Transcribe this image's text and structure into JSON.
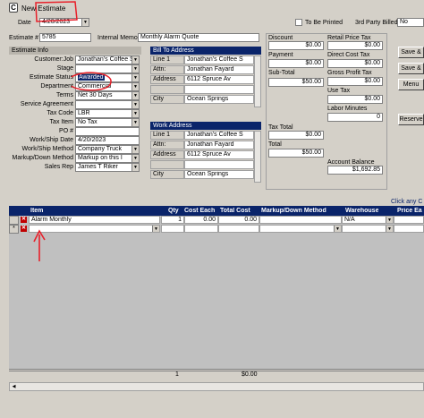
{
  "window": {
    "title": "New Estimate"
  },
  "header": {
    "date_label": "Date",
    "date_value": "4/20/2023",
    "to_be_printed": "To Be Printed",
    "third_party": "3rd Party Billed",
    "third_party_value": "No"
  },
  "estimate": {
    "number_label": "Estimate #",
    "number_value": "5785",
    "memo_label": "Internal Memo",
    "memo_value": "Monthly Alarm Quote"
  },
  "info": {
    "title": "Estimate Info",
    "rows": [
      {
        "label": "Customer:Job",
        "value": "Jonathan's Coffee S"
      },
      {
        "label": "Stage",
        "value": ""
      },
      {
        "label": "Estimate Status",
        "value": "Awarded"
      },
      {
        "label": "Department",
        "value": "Commercial"
      },
      {
        "label": "Terms",
        "value": "Net 30 Days"
      },
      {
        "label": "Service Agreement",
        "value": ""
      },
      {
        "label": "Tax Code",
        "value": "LBR"
      },
      {
        "label": "Tax Item",
        "value": "No Tax"
      },
      {
        "label": "PO #",
        "value": ""
      },
      {
        "label": "Work/Ship Date",
        "value": "4/20/2023"
      },
      {
        "label": "Work/Ship Method",
        "value": "Company Truck"
      },
      {
        "label": "Markup/Down Method",
        "value": "Markup on this I"
      },
      {
        "label": "Sales Rep",
        "value": "James T Riker"
      }
    ]
  },
  "bill_to": {
    "title": "Bill To Address",
    "rows": [
      {
        "label": "Line 1",
        "value": "Jonathan's Coffee S"
      },
      {
        "label": "Attn:",
        "value": "Jonathan Fayard"
      },
      {
        "label": "Address",
        "value": "6112 Spruce Av"
      },
      {
        "label": "",
        "value": ""
      },
      {
        "label": "City",
        "value": "Ocean Springs"
      }
    ]
  },
  "work_address": {
    "title": "Work Address",
    "rows": [
      {
        "label": "Line 1",
        "value": "Jonathan's Coffee S"
      },
      {
        "label": "Attn:",
        "value": "Jonathan Fayard"
      },
      {
        "label": "Address",
        "value": "6112 Spruce Av"
      },
      {
        "label": "",
        "value": ""
      },
      {
        "label": "City",
        "value": "Ocean Springs"
      }
    ]
  },
  "totals_left": {
    "discount_label": "Discount",
    "discount_value": "$0.00",
    "payment_label": "Payment",
    "payment_value": "$0.00",
    "subtotal_label": "Sub-Total",
    "subtotal_value": "$50.00",
    "taxtotal_label": "Tax Total",
    "taxtotal_value": "$0.00",
    "total_label": "Total",
    "total_value": "$50.00"
  },
  "totals_right": {
    "retail_label": "Retail Price Tax",
    "retail_value": "$0.00",
    "direct_label": "Direct Cost Tax",
    "direct_value": "$0.00",
    "gross_label": "Gross Profit Tax",
    "gross_value": "$0.00",
    "usetax_label": "Use Tax",
    "usetax_value": "$0.00",
    "labor_label": "Labor Minutes",
    "labor_value": "0",
    "balance_label": "Account Balance",
    "balance_value": "$1,692.85"
  },
  "buttons": {
    "save1": "Save &",
    "save2": "Save &",
    "menu": "Menu",
    "reserve": "Reserve"
  },
  "grid": {
    "click_hint": "Click any C",
    "columns": [
      "Item",
      "Qty",
      "Cost Each",
      "Total Cost",
      "Markup/Down Method",
      "Warehouse",
      "Price Ea"
    ],
    "row1": {
      "item": "Alarm Monthly",
      "qty": "1",
      "cost_each": "0.00",
      "total_cost": "0.00",
      "markup": "",
      "warehouse": "N/A",
      "price": ""
    },
    "row2_marker": "*"
  },
  "footer": {
    "qty_total": "1",
    "total_cost": "$0.00"
  },
  "colors": {
    "selection": "#0a246a",
    "annotation": "#e8202a"
  }
}
